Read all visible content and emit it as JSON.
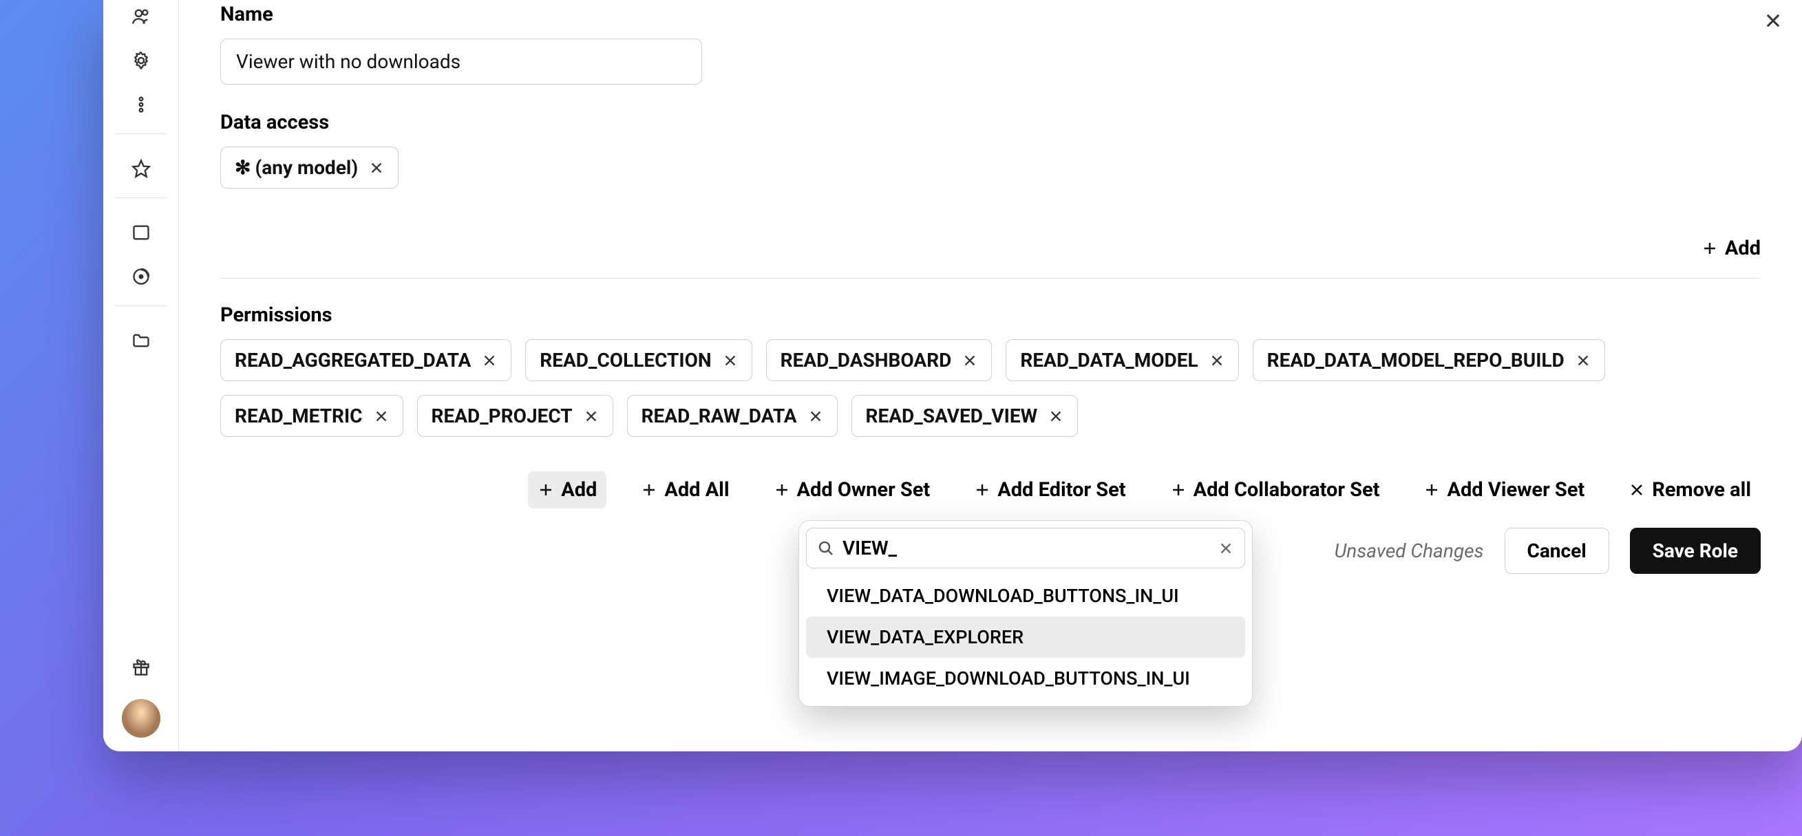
{
  "form": {
    "name_label": "Name",
    "name_value": "Viewer with no downloads",
    "data_access_label": "Data access",
    "data_access_chips": [
      {
        "label": "(any model)",
        "prefix": "✻"
      }
    ],
    "add_label": "Add",
    "permissions_label": "Permissions",
    "permissions_chips": [
      "READ_AGGREGATED_DATA",
      "READ_COLLECTION",
      "READ_DASHBOARD",
      "READ_DATA_MODEL",
      "READ_DATA_MODEL_REPO_BUILD",
      "READ_METRIC",
      "READ_PROJECT",
      "READ_RAW_DATA",
      "READ_SAVED_VIEW"
    ],
    "actions": {
      "add": "Add",
      "add_all": "Add All",
      "add_owner": "Add Owner Set",
      "add_editor": "Add Editor Set",
      "add_collab": "Add Collaborator Set",
      "add_viewer": "Add Viewer Set",
      "remove_all": "Remove all"
    },
    "footer": {
      "unsaved": "Unsaved Changes",
      "cancel": "Cancel",
      "save": "Save Role"
    }
  },
  "dropdown": {
    "search_value": "VIEW_",
    "items": [
      {
        "label": "VIEW_DATA_DOWNLOAD_BUTTONS_IN_UI",
        "highlight": false
      },
      {
        "label": "VIEW_DATA_EXPLORER",
        "highlight": true
      },
      {
        "label": "VIEW_IMAGE_DOWNLOAD_BUTTONS_IN_UI",
        "highlight": false
      }
    ]
  }
}
